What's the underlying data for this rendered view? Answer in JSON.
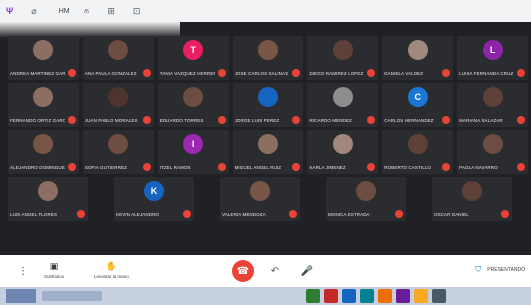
{
  "toolbar": {
    "items": [
      {
        "icon": "tb-icon-1",
        "glyph": "Ψ",
        "label": "",
        "accent": true
      },
      {
        "icon": "tb-icon-2",
        "glyph": "⌀",
        "label": "",
        "accent": false
      },
      {
        "icon": "tb-icon-3",
        "glyph": "",
        "label": "HM",
        "accent": false
      },
      {
        "icon": "tb-icon-4",
        "glyph": "க",
        "label": "",
        "accent": false
      },
      {
        "icon": "tb-icon-5",
        "glyph": "⊞",
        "label": "",
        "accent": false
      },
      {
        "icon": "tb-icon-6",
        "glyph": "⊡",
        "label": "",
        "accent": false
      }
    ]
  },
  "participants": [
    [
      {
        "initial": "",
        "color": "#8d6e63",
        "name": "ANDREA MARTINEZ GARCIA"
      },
      {
        "initial": "",
        "color": "#6d4c41",
        "name": "ANA PAULA GONZALEZ"
      },
      {
        "initial": "T",
        "color": "#e91e63",
        "name": "TANIA VAZQUEZ HERRERA"
      },
      {
        "initial": "",
        "color": "#795548",
        "name": "JOSE CARLOS SALINAS"
      },
      {
        "initial": "",
        "color": "#5d4037",
        "name": "DIEGO RAMIREZ LOPEZ"
      },
      {
        "initial": "",
        "color": "#a1887f",
        "name": "DANIELA VALDEZ"
      },
      {
        "initial": "L",
        "color": "#8e24aa",
        "name": "LUISA FERNANDA CRUZ"
      }
    ],
    [
      {
        "initial": "",
        "color": "#8d6e63",
        "name": "FERNANDO ORTIZ GARCIA"
      },
      {
        "initial": "",
        "color": "#4e342e",
        "name": "JUAN PABLO MORALES"
      },
      {
        "initial": "",
        "color": "#6d4c41",
        "name": "EDUARDO TORRES"
      },
      {
        "initial": "",
        "color": "#1565c0",
        "name": "JORGE LUIS PEREZ"
      },
      {
        "initial": "",
        "color": "#8d8d8d",
        "name": "RICARDO MENDEZ"
      },
      {
        "initial": "C",
        "color": "#1976d2",
        "name": "CARLOS HERNANDEZ"
      },
      {
        "initial": "",
        "color": "#5d4037",
        "name": "MARIANA SALAZAR"
      }
    ],
    [
      {
        "initial": "",
        "color": "#795548",
        "name": "ALEJANDRO DOMINGUEZ"
      },
      {
        "initial": "",
        "color": "#6d4c41",
        "name": "SOFIA GUTIERREZ"
      },
      {
        "initial": "I",
        "color": "#9c27b0",
        "name": "ITZEL RAMOS"
      },
      {
        "initial": "",
        "color": "#8d6e63",
        "name": "MIGUEL ANGEL RUIZ"
      },
      {
        "initial": "",
        "color": "#a1887f",
        "name": "KARLA JIMENEZ"
      },
      {
        "initial": "",
        "color": "#5d4037",
        "name": "ROBERTO CASTILLO"
      },
      {
        "initial": "",
        "color": "#6d4c41",
        "name": "PAOLA NAVARRO"
      }
    ],
    [
      {
        "initial": "",
        "color": "#8d6e63",
        "name": "LUIS ANGEL FLORES"
      },
      {
        "initial": "K",
        "color": "#1565c0",
        "name": "KEVIN ALEJANDRO"
      },
      {
        "initial": "",
        "color": "#795548",
        "name": "VALERIA MENDOZA"
      },
      {
        "initial": "",
        "color": "#6d4c41",
        "name": "MONICA ESTRADA"
      },
      {
        "initial": "",
        "color": "#5d4037",
        "name": "OSCAR DANIEL"
      }
    ]
  ],
  "bottombar": {
    "dots": "⋮",
    "groups": [
      {
        "glyph": "▣",
        "label": "Subtítulos"
      },
      {
        "glyph": "✋",
        "label": "Levantar la mano"
      }
    ],
    "controls": [
      {
        "glyph": "☎",
        "style": "end"
      },
      {
        "glyph": "↶",
        "style": "normal"
      },
      {
        "glyph": "🎤",
        "style": "normal"
      }
    ],
    "right_text": "PRESENTANDO"
  },
  "taskbar": {
    "apps": [
      "#2e7d32",
      "#c62828",
      "#1565c0",
      "#00838f",
      "#ef6c00",
      "#6a1b9a",
      "#f9a825",
      "#455a64"
    ]
  }
}
